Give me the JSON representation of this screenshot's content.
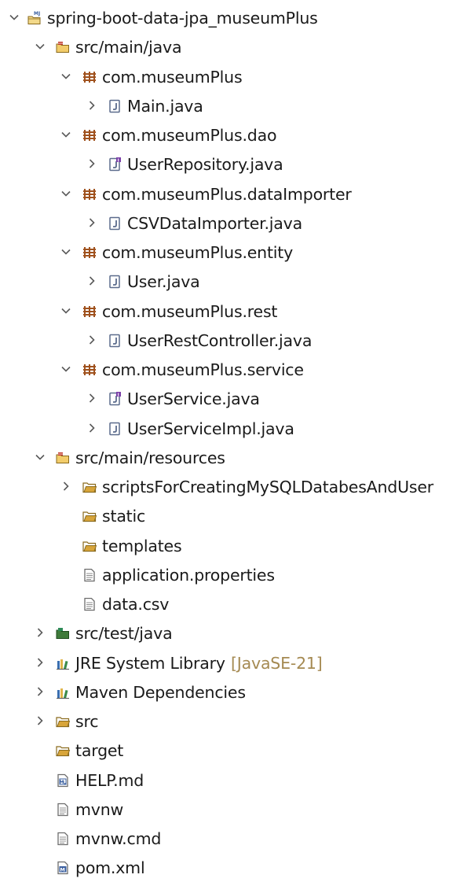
{
  "tree": [
    {
      "name": "spring-boot-data-jpa_museumPlus",
      "level": 0,
      "chevron": "down",
      "icon": "project",
      "label": "spring-boot-data-jpa_museumPlus"
    },
    {
      "name": "src-main-java",
      "level": 1,
      "chevron": "down",
      "icon": "source-folder",
      "label": "src/main/java"
    },
    {
      "name": "com-museumplus",
      "level": 2,
      "chevron": "down",
      "icon": "package",
      "label": "com.museumPlus"
    },
    {
      "name": "main-java",
      "level": 3,
      "chevron": "right",
      "icon": "java-class",
      "label": "Main.java"
    },
    {
      "name": "com-museumplus-dao",
      "level": 2,
      "chevron": "down",
      "icon": "package",
      "label": "com.museumPlus.dao"
    },
    {
      "name": "userrepository-java",
      "level": 3,
      "chevron": "right",
      "icon": "java-interface",
      "label": "UserRepository.java"
    },
    {
      "name": "com-museumplus-dataimporter",
      "level": 2,
      "chevron": "down",
      "icon": "package",
      "label": "com.museumPlus.dataImporter"
    },
    {
      "name": "csvdataimporter-java",
      "level": 3,
      "chevron": "right",
      "icon": "java-class",
      "label": "CSVDataImporter.java"
    },
    {
      "name": "com-museumplus-entity",
      "level": 2,
      "chevron": "down",
      "icon": "package",
      "label": "com.museumPlus.entity"
    },
    {
      "name": "user-java",
      "level": 3,
      "chevron": "right",
      "icon": "java-class",
      "label": "User.java"
    },
    {
      "name": "com-museumplus-rest",
      "level": 2,
      "chevron": "down",
      "icon": "package",
      "label": "com.museumPlus.rest"
    },
    {
      "name": "userrestcontroller-java",
      "level": 3,
      "chevron": "right",
      "icon": "java-class",
      "label": "UserRestController.java"
    },
    {
      "name": "com-museumplus-service",
      "level": 2,
      "chevron": "down",
      "icon": "package",
      "label": "com.museumPlus.service"
    },
    {
      "name": "userservice-java",
      "level": 3,
      "chevron": "right",
      "icon": "java-interface",
      "label": "UserService.java"
    },
    {
      "name": "userserviceimpl-java",
      "level": 3,
      "chevron": "right",
      "icon": "java-class",
      "label": "UserServiceImpl.java"
    },
    {
      "name": "src-main-resources",
      "level": 1,
      "chevron": "down",
      "icon": "source-folder",
      "label": "src/main/resources"
    },
    {
      "name": "scriptsforcreatingmysqldatabesanduser",
      "level": 2,
      "chevron": "right",
      "icon": "folder",
      "label": "scriptsForCreatingMySQLDatabesAndUser"
    },
    {
      "name": "static",
      "level": 2,
      "chevron": "none",
      "icon": "folder",
      "label": "static"
    },
    {
      "name": "templates",
      "level": 2,
      "chevron": "none",
      "icon": "folder",
      "label": "templates"
    },
    {
      "name": "application-properties",
      "level": 2,
      "chevron": "none",
      "icon": "text-file",
      "label": "application.properties"
    },
    {
      "name": "data-csv",
      "level": 2,
      "chevron": "none",
      "icon": "text-file",
      "label": "data.csv"
    },
    {
      "name": "src-test-java",
      "level": 1,
      "chevron": "right",
      "icon": "test-source-folder",
      "label": "src/test/java"
    },
    {
      "name": "jre-system-library",
      "level": 1,
      "chevron": "right",
      "icon": "library",
      "label": "JRE System Library",
      "decoration": "[JavaSE-21]"
    },
    {
      "name": "maven-dependencies",
      "level": 1,
      "chevron": "right",
      "icon": "library",
      "label": "Maven Dependencies"
    },
    {
      "name": "src",
      "level": 1,
      "chevron": "right",
      "icon": "folder",
      "label": "src"
    },
    {
      "name": "target",
      "level": 1,
      "chevron": "none",
      "icon": "folder",
      "label": "target"
    },
    {
      "name": "help-md",
      "level": 1,
      "chevron": "none",
      "icon": "markdown-file",
      "label": "HELP.md"
    },
    {
      "name": "mvnw",
      "level": 1,
      "chevron": "none",
      "icon": "text-file",
      "label": "mvnw"
    },
    {
      "name": "mvnw-cmd",
      "level": 1,
      "chevron": "none",
      "icon": "text-file",
      "label": "mvnw.cmd"
    },
    {
      "name": "pom-xml",
      "level": 1,
      "chevron": "none",
      "icon": "maven-pom-file",
      "label": "pom.xml"
    }
  ],
  "colors": {
    "text": "#1a1a1a",
    "chevron": "#5a5a5a",
    "decoration": "#a58a52",
    "package": "#a0521e",
    "folder": "#d8a53a",
    "java": "#5b6b8c",
    "library": "#3b6fb0"
  }
}
